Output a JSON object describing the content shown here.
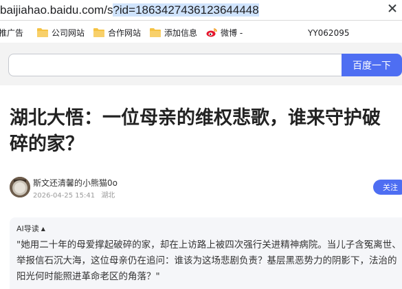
{
  "browser": {
    "url_host": "baijiahao.baidu.com",
    "url_path": "/s",
    "url_query": "?id=1863427436123644448"
  },
  "bookmarks": {
    "items": [
      {
        "label": "推广告",
        "icon": "folder-icon"
      },
      {
        "label": "公司网站",
        "icon": "folder-icon"
      },
      {
        "label": "合作网站",
        "icon": "folder-icon"
      },
      {
        "label": "添加信息",
        "icon": "folder-icon"
      },
      {
        "label": "微博 -",
        "icon": "weibo-icon"
      }
    ],
    "user": "YY062095"
  },
  "search": {
    "value": "",
    "button_label": "百度一下"
  },
  "article": {
    "title": "湖北大悟：一位母亲的维权悲歌，谁来守护破碎的家？",
    "author": "斯文还清馨的小熊猫0o",
    "date": "2026-04-25 15:41",
    "location": "湖北",
    "follow_label": "关注"
  },
  "ai_summary": {
    "heading": "AI导读",
    "caret": "▲",
    "text": "\"她用二十年的母爱撑起破碎的家，却在上访路上被四次强行关进精神病院。当儿子含冤离世、举报信石沉大海，这位母亲仍在追问：谁该为这场悲剧负责？基层黑恶势力的阴影下，法治的阳光何时能照进革命老区的角落？\""
  },
  "colors": {
    "accent": "#4e6ef2",
    "url_selection": "#cfe3fc",
    "folder": "#f5c242",
    "weibo": "#e6162d"
  }
}
